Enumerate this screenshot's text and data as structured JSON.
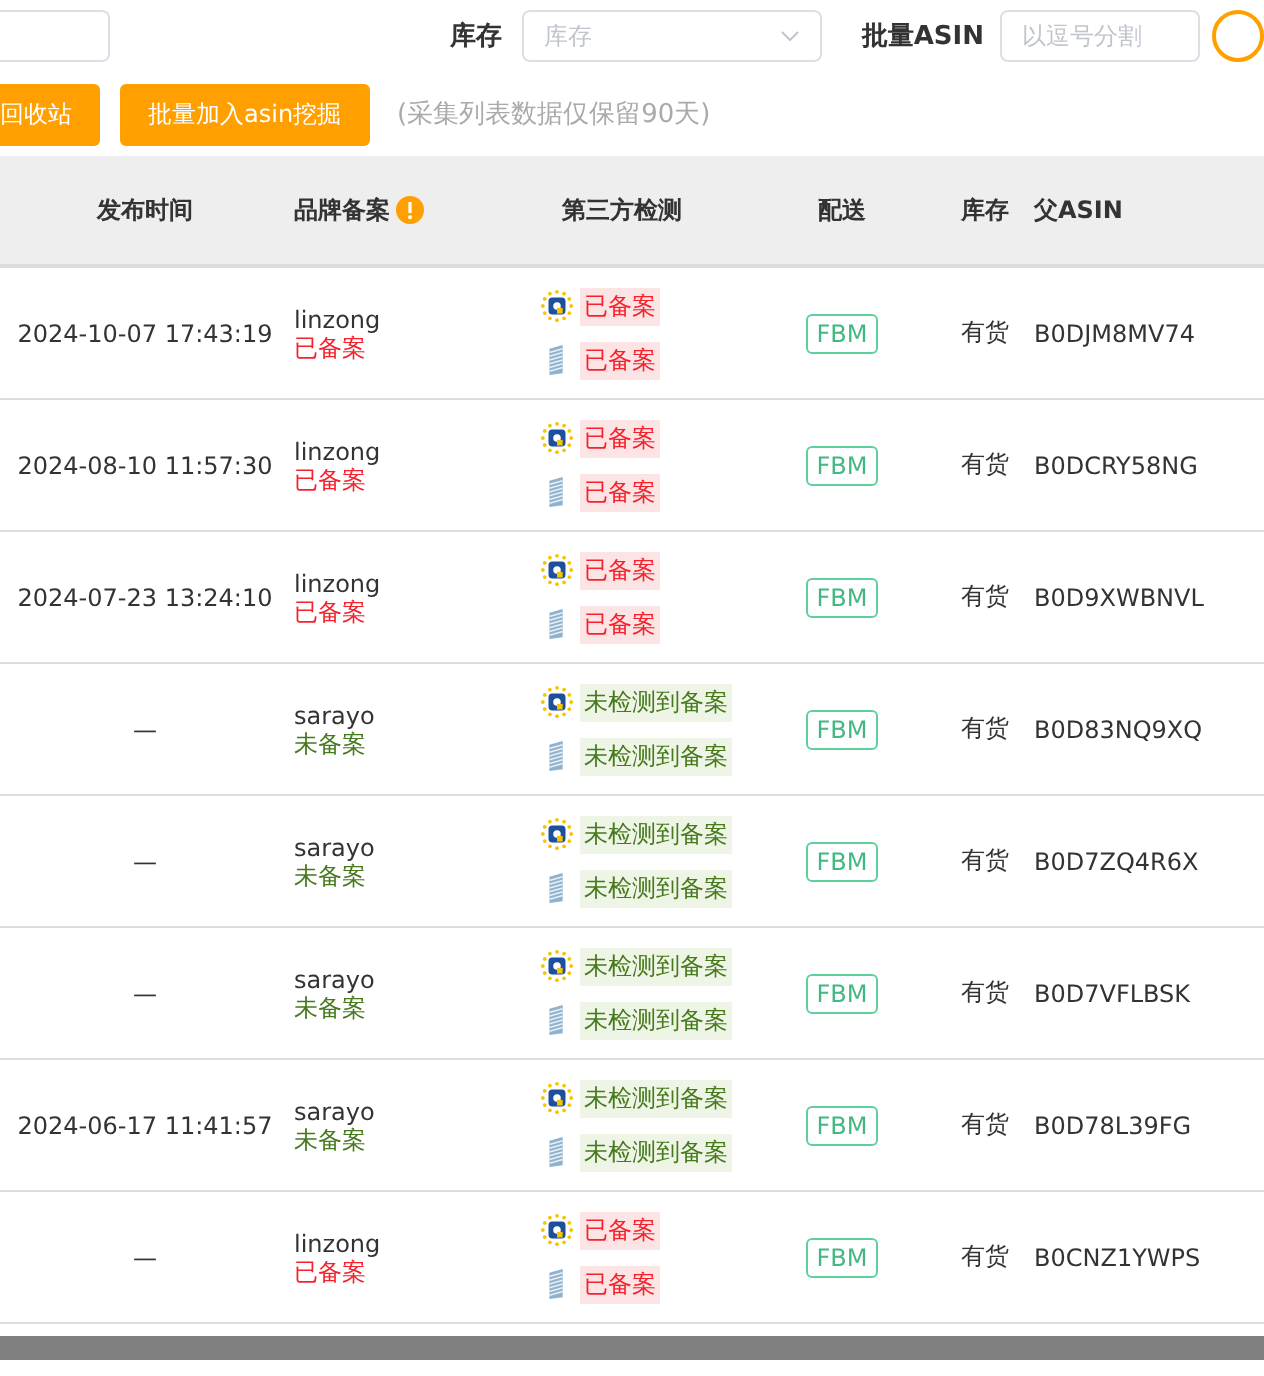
{
  "filters": [
    {
      "label": "库存",
      "placeholder": "库存"
    },
    {
      "label": "批量ASIN",
      "placeholder": "以逗号分割"
    }
  ],
  "buttons": [
    "回收站",
    "批量加入asin挖掘"
  ],
  "note": "(采集列表数据仅保留90天)",
  "table": {
    "columns": [
      "发布时间",
      "品牌备案",
      "第三方检测",
      "配送",
      "库存",
      "父ASIN"
    ],
    "rows": [
      {
        "time": "2024-10-07 17:43:19",
        "brand": "linzong",
        "brand_status": {
          "text": "已备案",
          "kind": "registered"
        },
        "checks": [
          {
            "text": "已备案",
            "kind": "registered"
          },
          {
            "text": "已备案",
            "kind": "registered"
          }
        ],
        "shipping": "FBM",
        "stock": "有货",
        "asin": "B0DJM8MV74"
      },
      {
        "time": "2024-08-10 11:57:30",
        "brand": "linzong",
        "brand_status": {
          "text": "已备案",
          "kind": "registered"
        },
        "checks": [
          {
            "text": "已备案",
            "kind": "registered"
          },
          {
            "text": "已备案",
            "kind": "registered"
          }
        ],
        "shipping": "FBM",
        "stock": "有货",
        "asin": "B0DCRY58NG"
      },
      {
        "time": "2024-07-23 13:24:10",
        "brand": "linzong",
        "brand_status": {
          "text": "已备案",
          "kind": "registered"
        },
        "checks": [
          {
            "text": "已备案",
            "kind": "registered"
          },
          {
            "text": "已备案",
            "kind": "registered"
          }
        ],
        "shipping": "FBM",
        "stock": "有货",
        "asin": "B0D9XWBNVL"
      },
      {
        "time": "—",
        "brand": "sarayo",
        "brand_status": {
          "text": "未备案",
          "kind": "unregistered"
        },
        "checks": [
          {
            "text": "未检测到备案",
            "kind": "unregistered"
          },
          {
            "text": "未检测到备案",
            "kind": "unregistered"
          }
        ],
        "shipping": "FBM",
        "stock": "有货",
        "asin": "B0D83NQ9XQ"
      },
      {
        "time": "—",
        "brand": "sarayo",
        "brand_status": {
          "text": "未备案",
          "kind": "unregistered"
        },
        "checks": [
          {
            "text": "未检测到备案",
            "kind": "unregistered"
          },
          {
            "text": "未检测到备案",
            "kind": "unregistered"
          }
        ],
        "shipping": "FBM",
        "stock": "有货",
        "asin": "B0D7ZQ4R6X"
      },
      {
        "time": "—",
        "brand": "sarayo",
        "brand_status": {
          "text": "未备案",
          "kind": "unregistered"
        },
        "checks": [
          {
            "text": "未检测到备案",
            "kind": "unregistered"
          },
          {
            "text": "未检测到备案",
            "kind": "unregistered"
          }
        ],
        "shipping": "FBM",
        "stock": "有货",
        "asin": "B0D7VFLBSK"
      },
      {
        "time": "2024-06-17 11:41:57",
        "brand": "sarayo",
        "brand_status": {
          "text": "未备案",
          "kind": "unregistered"
        },
        "checks": [
          {
            "text": "未检测到备案",
            "kind": "unregistered"
          },
          {
            "text": "未检测到备案",
            "kind": "unregistered"
          }
        ],
        "shipping": "FBM",
        "stock": "有货",
        "asin": "B0D78L39FG"
      },
      {
        "time": "—",
        "brand": "linzong",
        "brand_status": {
          "text": "已备案",
          "kind": "registered"
        },
        "checks": [
          {
            "text": "已备案",
            "kind": "registered"
          },
          {
            "text": "已备案",
            "kind": "registered"
          }
        ],
        "shipping": "FBM",
        "stock": "有货",
        "asin": "B0CNZ1YWPS"
      }
    ]
  }
}
